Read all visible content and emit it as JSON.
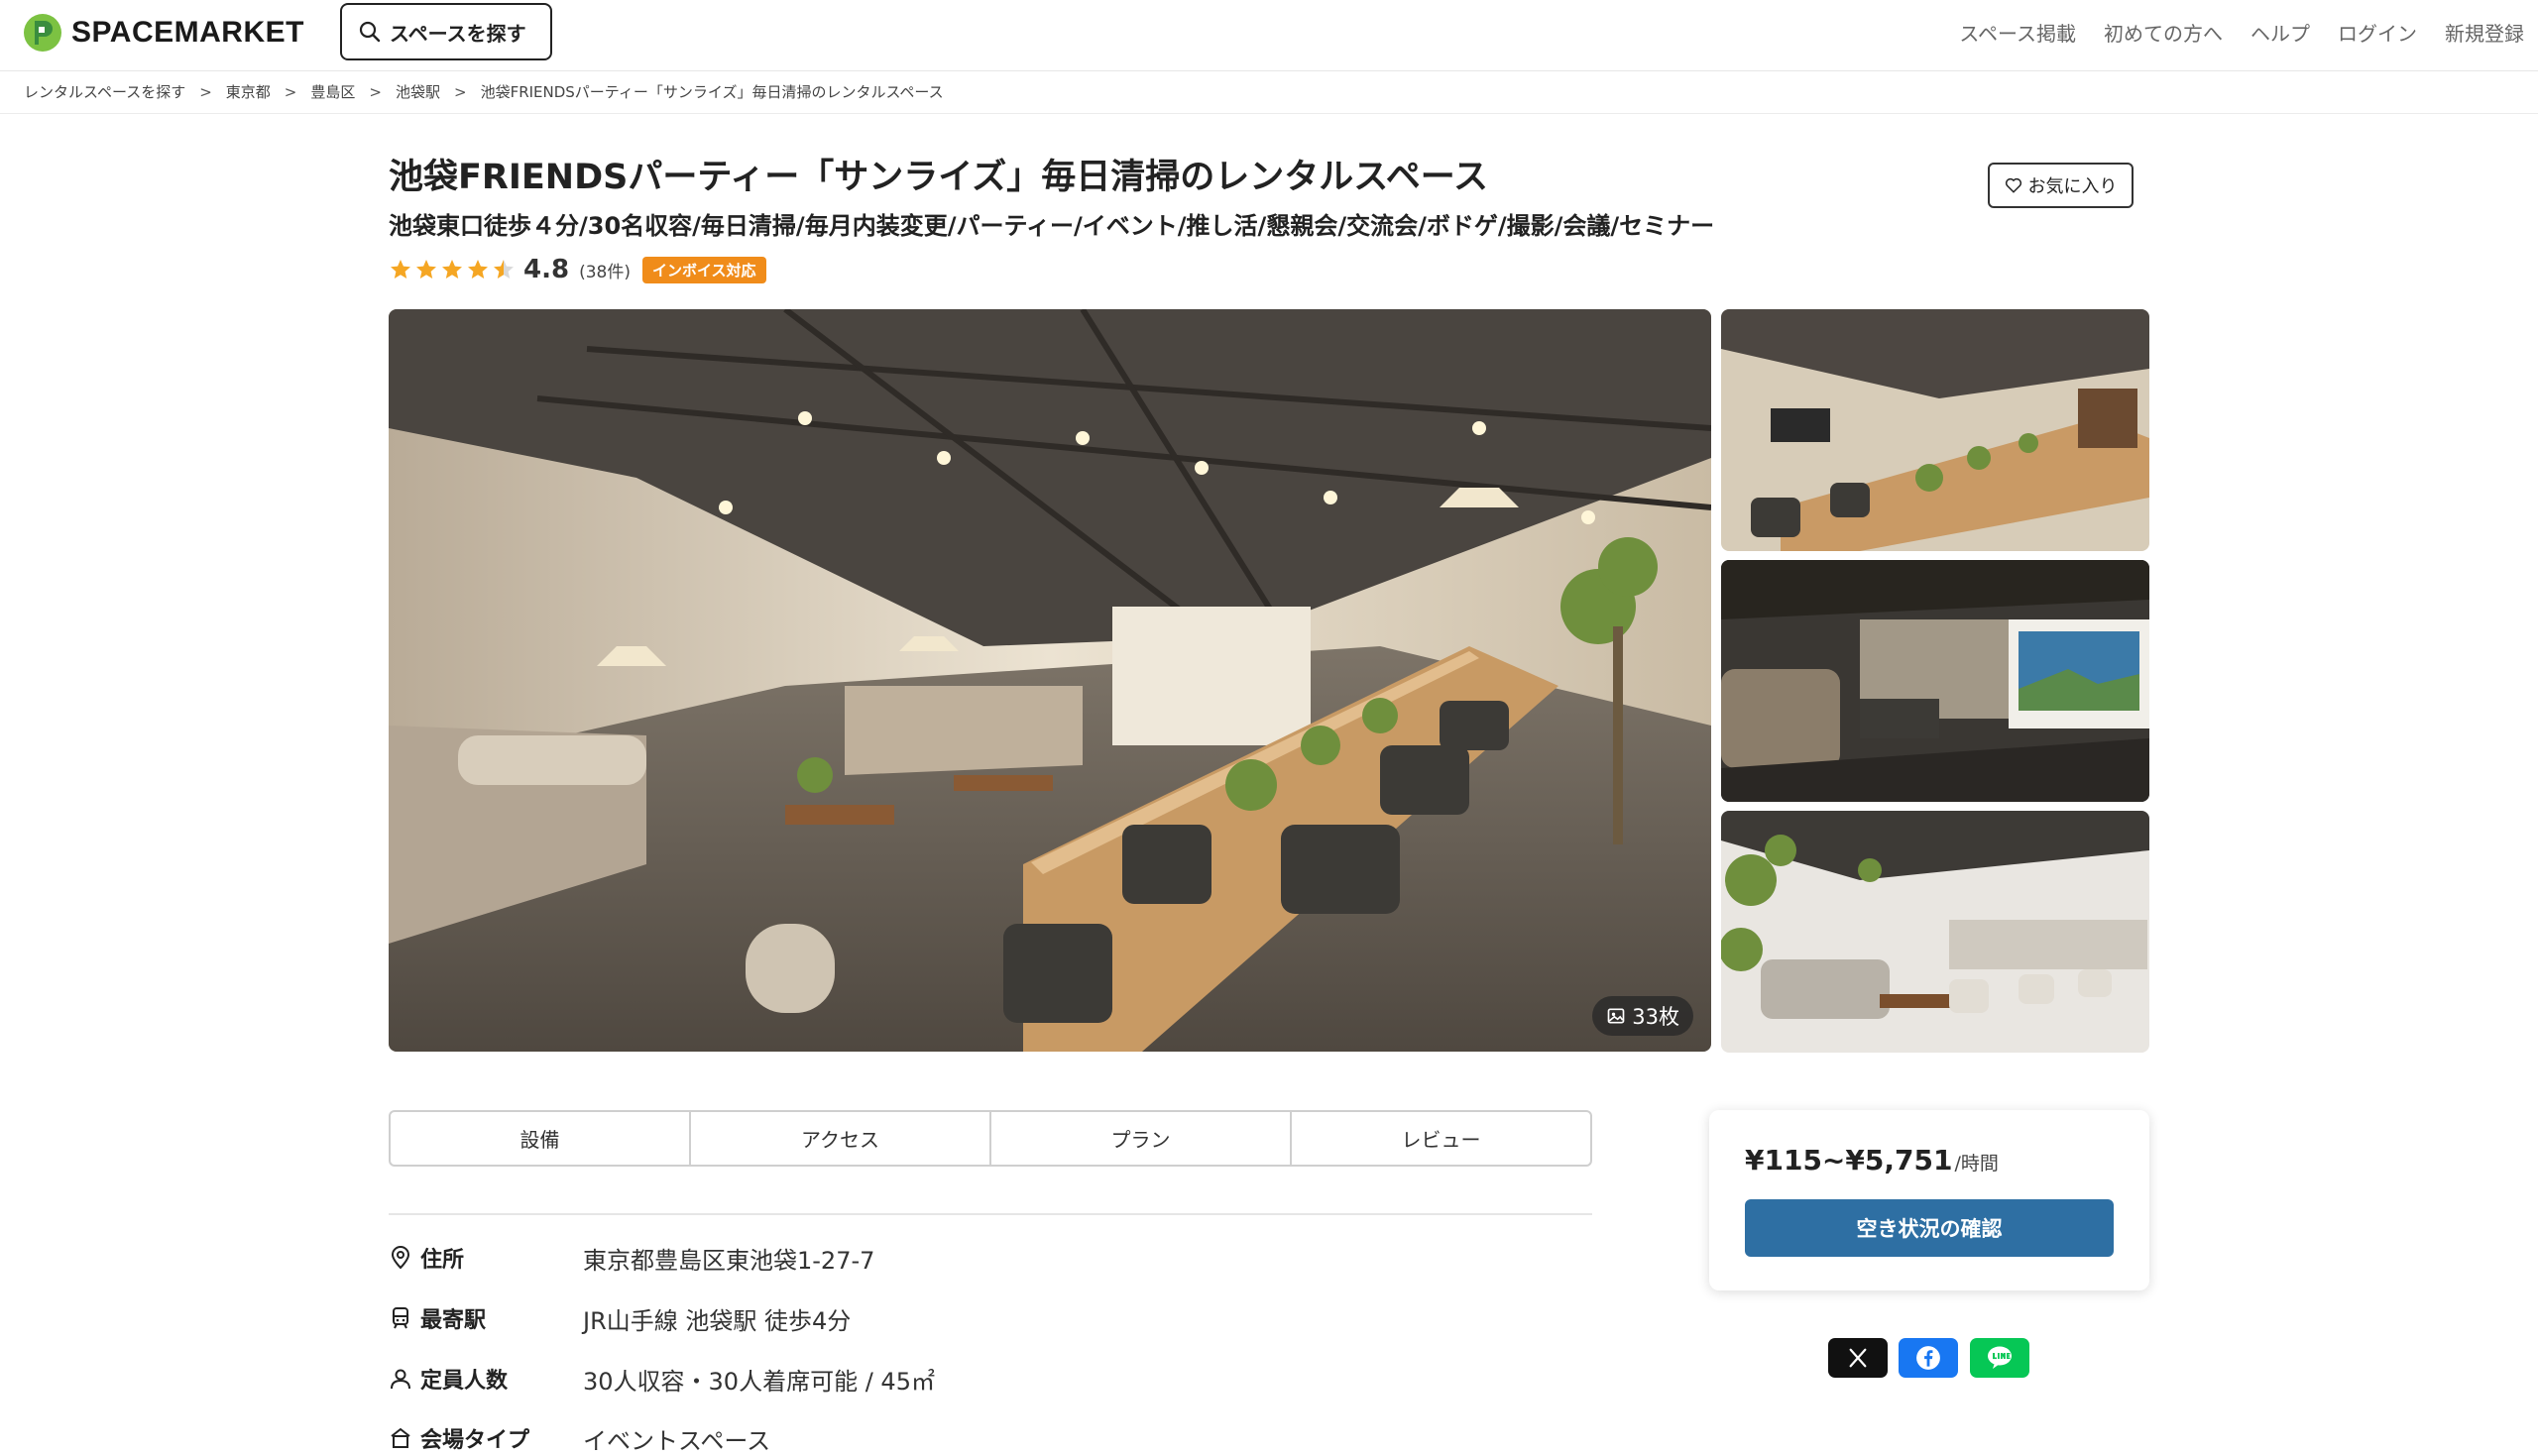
{
  "header": {
    "logo_text": "SPACEMARKET",
    "search_label": "スペースを探す",
    "nav": [
      "スペース掲載",
      "初めての方へ",
      "ヘルプ",
      "ログイン",
      "新規登録"
    ]
  },
  "breadcrumb": [
    "レンタルスペースを探す",
    "東京都",
    "豊島区",
    "池袋駅",
    "池袋FRIENDSパーティー「サンライズ」毎日清掃のレンタルスペース"
  ],
  "breadcrumb_sep": ">",
  "space": {
    "title": "池袋FRIENDSパーティー「サンライズ」毎日清掃のレンタルスペース",
    "subtitle": "池袋東口徒歩４分/30名収容/毎日清掃/毎月内装変更/パーティー/イベント/推し活/懇親会/交流会/ボドゲ/撮影/会議/セミナー",
    "favorite_label": "お気に入り",
    "rating": "4.8",
    "stars": 4.5,
    "review_count": "(38件)",
    "invoice_badge": "インボイス対応",
    "photo_count": "33枚"
  },
  "tabs": [
    "設備",
    "アクセス",
    "プラン",
    "レビュー"
  ],
  "info": [
    {
      "icon": "location-pin-icon",
      "label": "住所",
      "value": "東京都豊島区東池袋1-27-7"
    },
    {
      "icon": "train-icon",
      "label": "最寄駅",
      "value": "JR山手線 池袋駅 徒歩4分"
    },
    {
      "icon": "person-icon",
      "label": "定員人数",
      "value": "30人収容・30人着席可能 / 45㎡"
    },
    {
      "icon": "building-icon",
      "label": "会場タイプ",
      "value": "イベントスペース"
    }
  ],
  "price_card": {
    "price": "¥115~¥5,751",
    "unit": "/時間",
    "availability_button": "空き状況の確認"
  },
  "share": [
    "x-icon",
    "facebook-icon",
    "line-icon"
  ],
  "colors": {
    "brand_green": "#7cc242",
    "star": "#f5a623",
    "badge": "#f08c1a",
    "primary_button": "#2e6fa3",
    "facebook": "#1877f2",
    "line": "#06c755"
  }
}
